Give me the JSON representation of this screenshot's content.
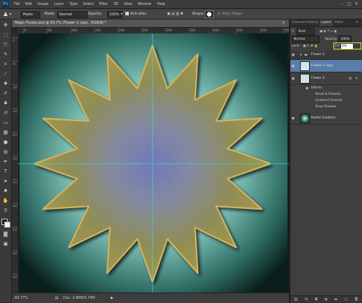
{
  "app": {
    "logo": "Ps"
  },
  "menu": [
    "File",
    "Edit",
    "Image",
    "Layer",
    "Type",
    "Select",
    "Filter",
    "3D",
    "View",
    "Window",
    "Help"
  ],
  "window_buttons": [
    "–",
    "□",
    "✕"
  ],
  "options": {
    "pixels_label": "Pixels",
    "mode_label": "Mode:",
    "mode_value": "Normal",
    "opacity_label": "Opacity:",
    "opacity_value": "100%",
    "antialias_label": "Anti-alias",
    "shape_label": "Shape:",
    "align_edges_label": "Align Edges"
  },
  "document": {
    "tab_title": "Magic Flower.psd @ 83.7% (Flower 2  copy , RGB/8) *",
    "zoom": "83.77%",
    "doc_size": "Doc: 2.86M/5.74M"
  },
  "ruler": {
    "h_marks": [
      "0",
      "50",
      "100",
      "150",
      "200",
      "250",
      "300",
      "350",
      "400",
      "450",
      "500",
      "550"
    ],
    "v_marks": [
      "0",
      "50",
      "100",
      "150",
      "200",
      "250",
      "300",
      "350",
      "400",
      "450",
      "500"
    ]
  },
  "layers_panel": {
    "tabs": [
      "Channels",
      "History",
      "Layers",
      "Paths"
    ],
    "active_tab": "Layers",
    "filter_kind": "Kind",
    "blend_mode": "Normal",
    "opacity_label": "Opacity:",
    "opacity_value": "100%",
    "lock_label": "Lock:",
    "fill_label": "Fill:",
    "fill_value": "0%",
    "group_name": "Flower 2",
    "layers": [
      {
        "name": "Flower 2  copy"
      },
      {
        "name": "Flower 2",
        "effects_label": "Effects",
        "effects": [
          "Bevel & Emboss",
          "Gradient Overlay",
          "Drop Shadow"
        ]
      },
      {
        "name": "Radial Gradient"
      }
    ]
  },
  "colors": {
    "canvas_center": "#d8f0ee",
    "canvas_edge": "#0b2520",
    "flower": "#8c8a48",
    "flower_rim": "#c9aa4a",
    "guide": "#3fd5d0",
    "highlight": "#ece13a"
  }
}
